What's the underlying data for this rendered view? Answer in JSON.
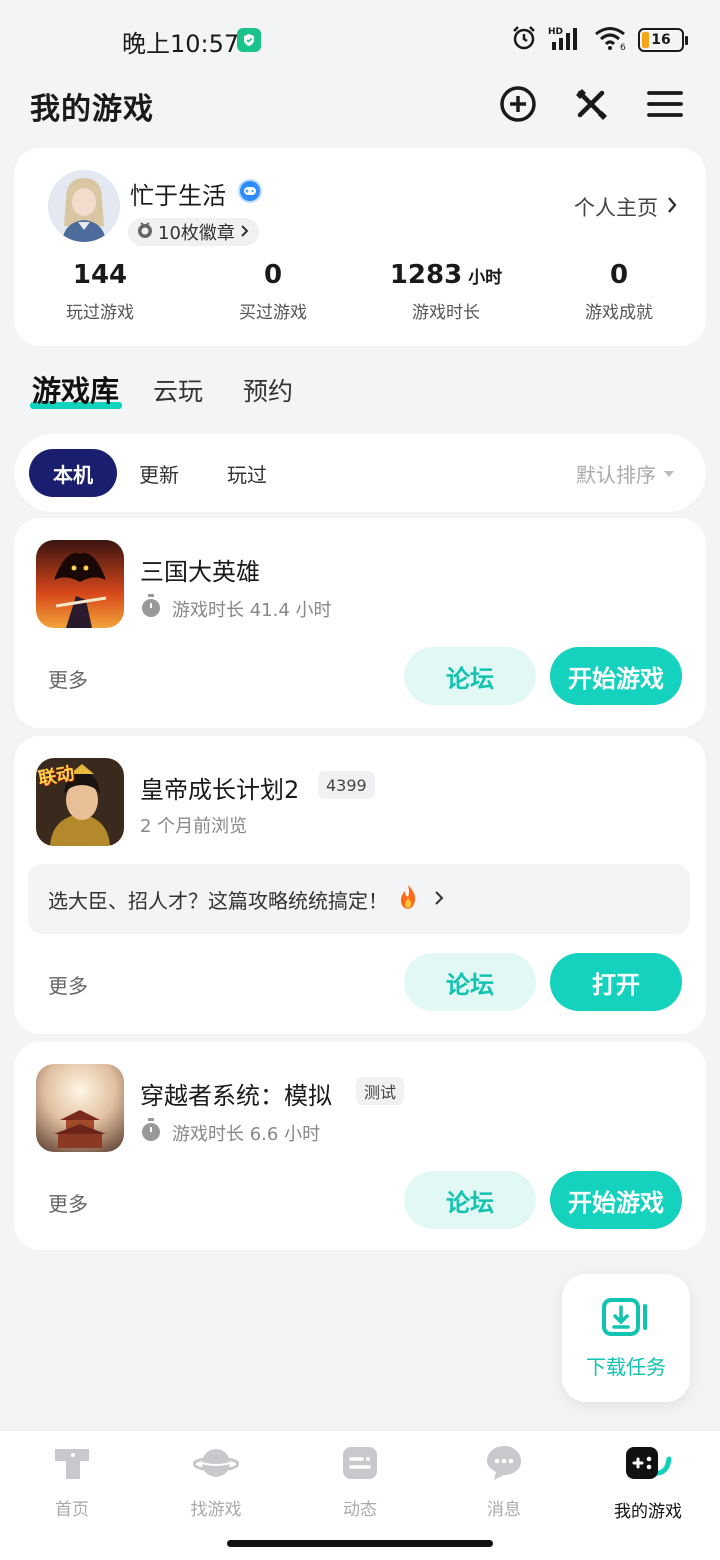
{
  "status_bar": {
    "time": "晚上10:57",
    "battery": "16"
  },
  "header": {
    "title": "我的游戏"
  },
  "profile": {
    "username": "忙于生活",
    "badges": "10枚徽章",
    "homepage_link": "个人主页",
    "stats": [
      {
        "value": "144",
        "unit": "",
        "label": "玩过游戏"
      },
      {
        "value": "0",
        "unit": "",
        "label": "买过游戏"
      },
      {
        "value": "1283",
        "unit": "小时",
        "label": "游戏时长"
      },
      {
        "value": "0",
        "unit": "",
        "label": "游戏成就"
      }
    ]
  },
  "main_tabs": [
    "游戏库",
    "云玩",
    "预约"
  ],
  "filters": {
    "chips": [
      "本机",
      "更新",
      "玩过"
    ],
    "sort": "默认排序"
  },
  "games": [
    {
      "name": "三国大英雄",
      "meta": "游戏时长 41.4 小时",
      "more": "更多",
      "forum": "论坛",
      "action": "开始游戏"
    },
    {
      "name": "皇帝成长计划2",
      "tag": "4399",
      "meta": "2 个月前浏览",
      "tip": "选大臣、招人才？这篇攻略统统搞定！",
      "more": "更多",
      "forum": "论坛",
      "action": "打开",
      "icon_text": "联动"
    },
    {
      "name": "穿越者系统：模拟",
      "tag": "测试",
      "meta": "游戏时长 6.6 小时",
      "more": "更多",
      "forum": "论坛",
      "action": "开始游戏"
    }
  ],
  "download_task": "下载任务",
  "bottom_nav": [
    "首页",
    "找游戏",
    "动态",
    "消息",
    "我的游戏"
  ],
  "colors": {
    "accent": "#14d2bd",
    "chip_active": "#1a1e6e"
  }
}
